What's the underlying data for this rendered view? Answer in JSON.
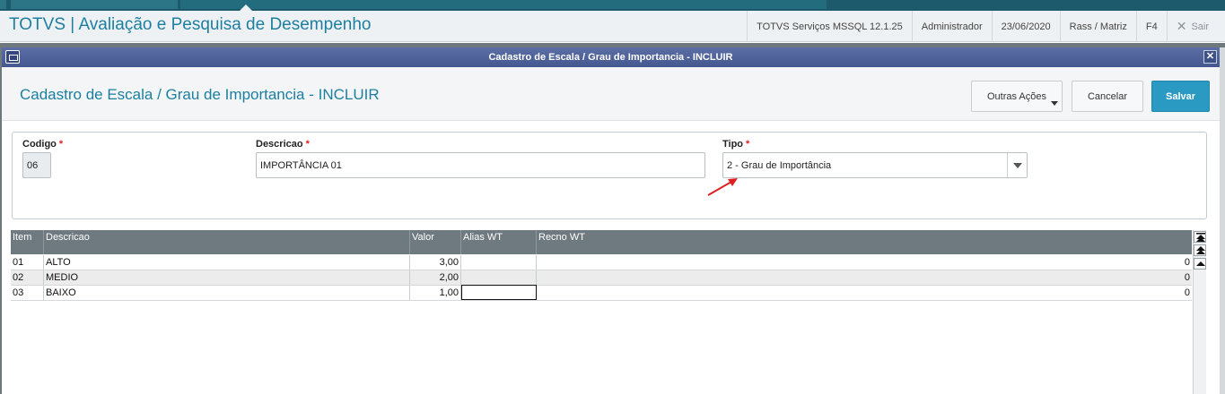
{
  "app": {
    "title": "TOTVS | Avaliação e Pesquisa de Desempenho",
    "environment": "TOTVS Serviços MSSQL 12.1.25",
    "user": "Administrador",
    "date": "23/06/2020",
    "branch": "Rass / Matriz",
    "shortcut": "F4",
    "exit_label": "Sair",
    "exit_icon": "close-icon"
  },
  "dialog": {
    "window_title": "Cadastro de Escala / Grau de Importancia - INCLUIR",
    "page_title": "Cadastro de Escala / Grau de Importancia - INCLUIR",
    "buttons": {
      "other_actions": "Outras Ações",
      "cancel": "Cancelar",
      "save": "Salvar"
    }
  },
  "form": {
    "codigo": {
      "label": "Codigo",
      "value": "06",
      "required": "*"
    },
    "descricao": {
      "label": "Descricao",
      "value": "IMPORTÂNCIA 01",
      "required": "*"
    },
    "tipo": {
      "label": "Tipo",
      "value": "2 - Grau de Importância",
      "required": "*"
    }
  },
  "grid": {
    "columns": [
      "Item",
      "Descricao",
      "Valor",
      "Alias WT",
      "Recno WT"
    ],
    "rows": [
      {
        "item": "01",
        "descricao": "ALTO",
        "valor": "3,00",
        "alias": "",
        "recno": "0"
      },
      {
        "item": "02",
        "descricao": "MEDIO",
        "valor": "2,00",
        "alias": "",
        "recno": "0"
      },
      {
        "item": "03",
        "descricao": "BAIXO",
        "valor": "1,00",
        "alias": "",
        "recno": "0"
      }
    ]
  },
  "colors": {
    "accent": "#1d7fa0",
    "save_button": "#2b9ac2",
    "required": "#e02020",
    "annotation_arrow": "#e02020"
  }
}
